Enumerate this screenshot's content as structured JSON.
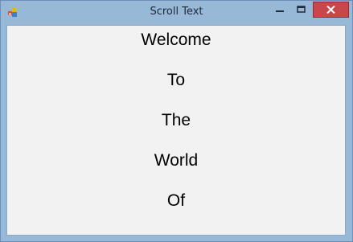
{
  "window": {
    "title": "Scroll Text",
    "close_color": "#c9464b",
    "frame_color": "#98b8d8",
    "client_color": "#f2f2f2"
  },
  "icons": {
    "app": "app-icon",
    "minimize": "minimize-icon",
    "maximize": "maximize-icon",
    "close": "close-icon"
  },
  "content": {
    "lines": [
      "Welcome",
      "To",
      "The",
      "World",
      "Of"
    ]
  }
}
